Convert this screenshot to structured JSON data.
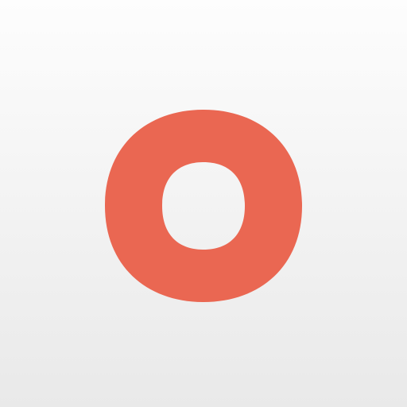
{
  "app_icon": {
    "icon_name": "ring-logo-icon",
    "colors": {
      "accent": "#ea6752",
      "background_top": "#fdfdfd",
      "background_bottom": "#e9e9e9"
    }
  }
}
